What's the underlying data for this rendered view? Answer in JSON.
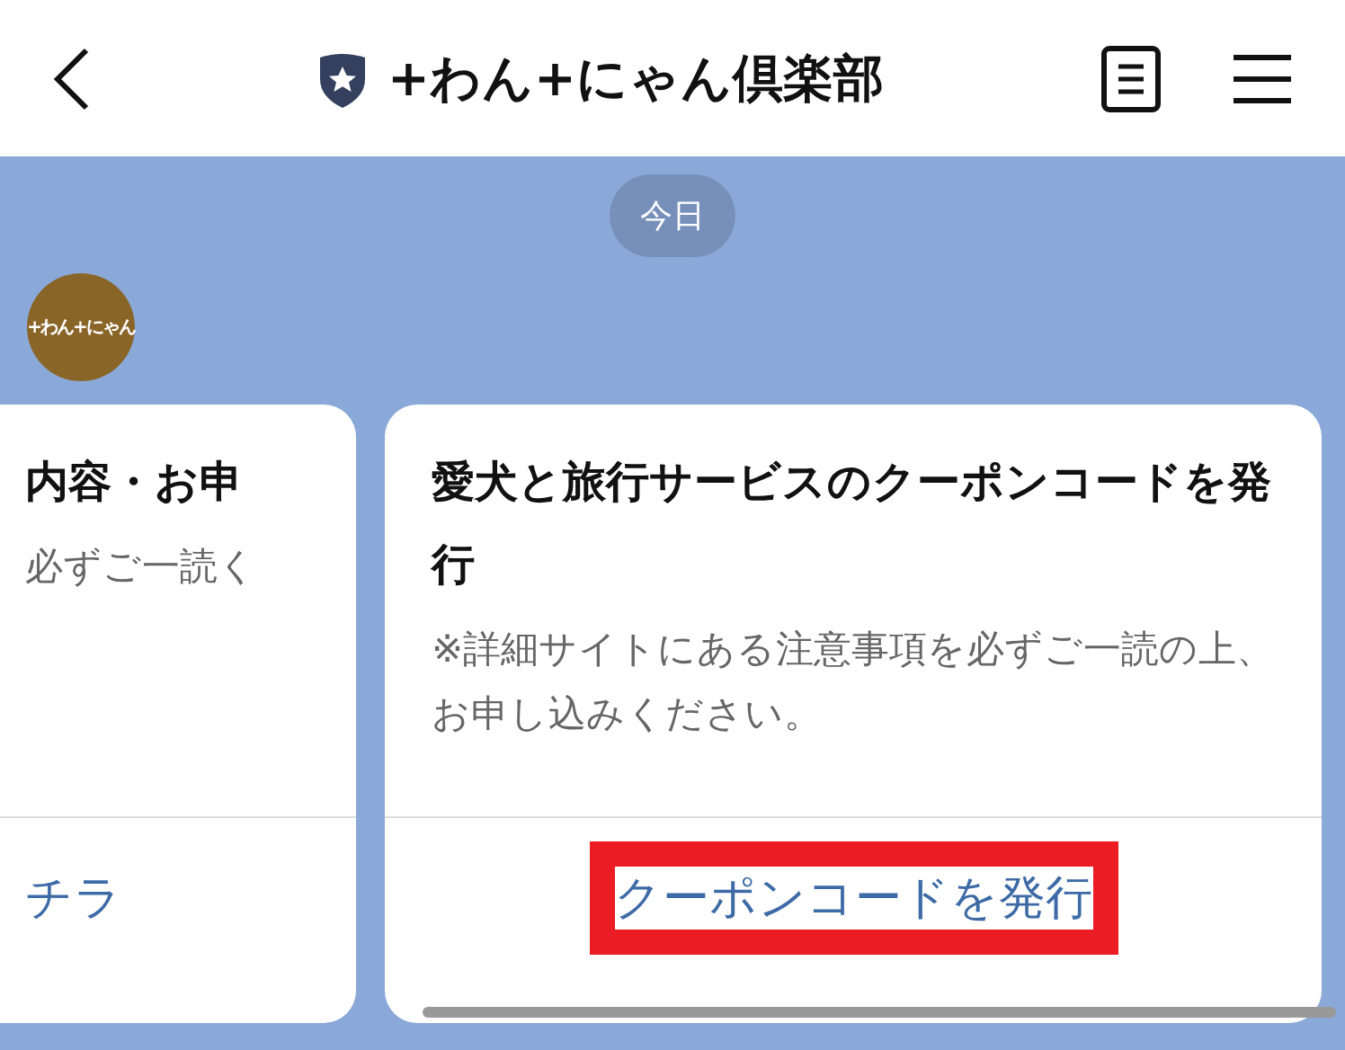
{
  "header": {
    "title": "+わん+にゃん倶楽部",
    "verified": true
  },
  "date_label": "今日",
  "sender": {
    "avatar_text": "+わん+にゃん"
  },
  "cards": [
    {
      "title": "内容・お申",
      "description": "必ずご一読く",
      "link": {
        "label": "チラ",
        "highlighted": false
      }
    },
    {
      "title": "愛犬と旅行サービスのクーポンコードを発行",
      "description": "※詳細サイトにある注意事項を必ずご一読の上、お申し込みください。",
      "link": {
        "label": "クーポンコードを発行",
        "highlighted": true
      }
    }
  ]
}
